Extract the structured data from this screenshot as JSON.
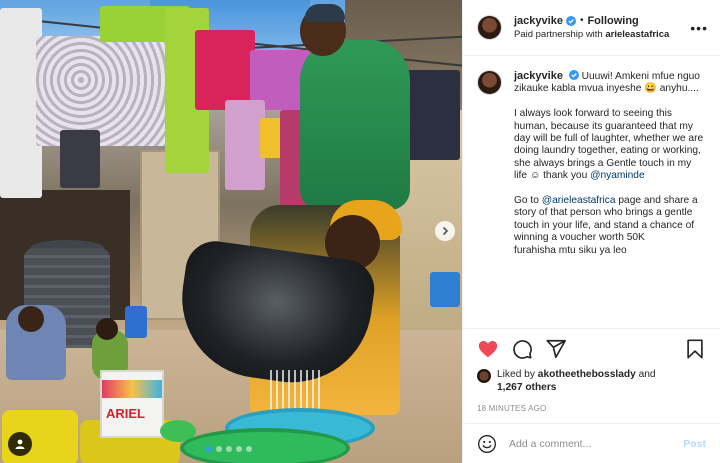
{
  "post": {
    "author": {
      "username": "jackyvike",
      "verified": true,
      "follow_state": "Following",
      "separator": "•",
      "partnership_prefix": "Paid partnership with",
      "partner": "arieleastafrica"
    },
    "photo": {
      "carousel_dots": 5,
      "active_dot": 1,
      "product_label": "ARIEL"
    },
    "caption": {
      "username": "jackyvike",
      "paragraph1": "Uuuwi! Amkeni mfue nguo zikauke kabla mvua inyeshe 😀 anyhu....",
      "paragraph2": "I always look forward to seeing this human, because its guaranteed that my day will be full of laughter, whether we are doing laundry together, eating or working, she always brings a Gentle touch in my life ☺ thank you",
      "mention2": "@nyaminde",
      "paragraph3_prefix": "Go to",
      "mention3": "@arieleastafrica",
      "paragraph3_suffix": "page and share a story of that person who brings a gentle touch in your life, and stand a chance of winning a voucher worth 50K",
      "paragraph3_end": "furahisha mtu siku ya leo"
    },
    "likes": {
      "prefix": "Liked by",
      "liker": "akotheethebosslady",
      "and": "and",
      "others": "1,267 others"
    },
    "timestamp": "18 MINUTES AGO",
    "comment": {
      "placeholder": "Add a comment...",
      "post_label": "Post"
    },
    "colors": {
      "link": "#00376b",
      "like_red": "#ed4956",
      "verified_blue": "#3897f0",
      "post_button": "#b3dbff"
    },
    "icons": [
      "verified-badge-icon",
      "more-options-icon",
      "heart-icon",
      "comment-icon",
      "share-icon",
      "bookmark-icon",
      "emoji-icon",
      "chevron-right-icon",
      "user-tag-icon"
    ]
  }
}
